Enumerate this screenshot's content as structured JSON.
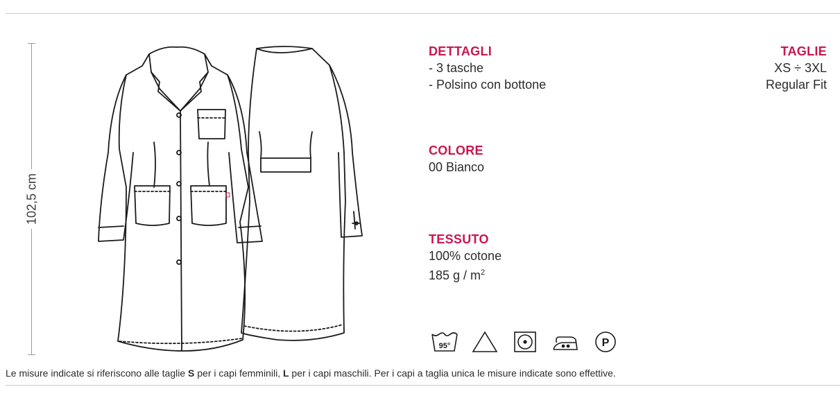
{
  "measure": {
    "label": "102,5 cm"
  },
  "details": {
    "title": "DETTAGLI",
    "items": [
      "- 3 tasche",
      "- Polsino con bottone"
    ]
  },
  "color": {
    "title": "COLORE",
    "value": "00 Bianco"
  },
  "fabric": {
    "title": "TESSUTO",
    "composition": "100% cotone",
    "weight_prefix": "185 g / m",
    "weight_exp": "2"
  },
  "sizes": {
    "title": "TAGLIE",
    "range": "XS ÷ 3XL",
    "fit": "Regular Fit"
  },
  "care": {
    "wash_temp": "95°",
    "dryclean_letter": "P",
    "icons": [
      "wash-95-icon",
      "bleach-triangle-icon",
      "tumble-dry-icon",
      "iron-two-dots-icon",
      "dry-clean-p-icon"
    ]
  },
  "note": {
    "part1": "Le misure indicate si riferiscono alle taglie ",
    "size_s": "S",
    "part2": " per i capi femminili, ",
    "size_l": "L",
    "part3": " per i capi maschili. Per i capi a taglia unica le misure indicate sono effettive."
  },
  "colors": {
    "accent": "#c8174f",
    "text": "#2b2b2b",
    "rule": "#c9c9c9"
  }
}
